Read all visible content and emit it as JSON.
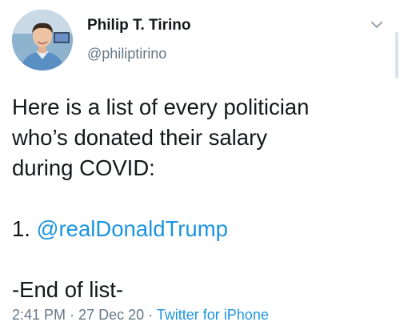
{
  "author": {
    "name": "Philip T. Tirino",
    "handle": "@philiptirino"
  },
  "tweet": {
    "lines": [
      "Here is a list of every politician",
      "who’s donated their salary",
      "during COVID:"
    ],
    "list_number": "1. ",
    "mention": "@realDonaldTrump",
    "closing": "-End of list-"
  },
  "meta": {
    "time": "2:41 PM",
    "separator1": " · ",
    "date": "27 Dec 20",
    "separator2": " · ",
    "source": "Twitter for iPhone"
  },
  "colors": {
    "link": "#1b95e0",
    "secondary_text": "#657786",
    "primary_text": "#14171a"
  },
  "icons": {
    "menu": "chevron-down-icon"
  }
}
